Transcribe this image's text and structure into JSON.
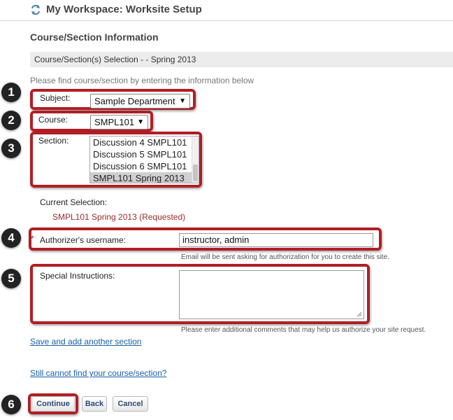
{
  "header": {
    "title": "My Workspace: Worksite Setup",
    "icon": "refresh-icon"
  },
  "section_title": "Course/Section Information",
  "selection_bar": "Course/Section(s) Selection - - Spring 2013",
  "instruction": "Please find course/section by entering the information below",
  "subject": {
    "label": "Subject:",
    "value": "Sample Department"
  },
  "course": {
    "label": "Course:",
    "value": "SMPL101"
  },
  "section": {
    "label": "Section:",
    "options": [
      "Discussion 4 SMPL101",
      "Discussion 5 SMPL101",
      "Discussion 6 SMPL101",
      "SMPL101 Spring 2013"
    ],
    "selected": "SMPL101 Spring 2013"
  },
  "current_selection": {
    "label": "Current Selection:",
    "value": "SMPL101 Spring 2013 (Requested)"
  },
  "authorizer": {
    "required_mark": "*",
    "label": "Authorizer's username:",
    "value": "instructor, admin",
    "help": "Email will be sent asking for authorization for you to create this site."
  },
  "special": {
    "label": "Special Instructions:",
    "value": "",
    "help": "Please enter additional comments that may help us authorize your site request."
  },
  "links": {
    "save_add": "Save and add another section",
    "cannot_find": "Still cannot find your course/section?"
  },
  "buttons": {
    "continue": "Continue",
    "back": "Back",
    "cancel": "Cancel"
  },
  "badges": [
    "1",
    "2",
    "3",
    "4",
    "5",
    "6"
  ],
  "colors": {
    "highlight": "#b01e25",
    "link": "#1a5fa8",
    "current_value": "#9c2a2a",
    "badge": "#222222"
  }
}
